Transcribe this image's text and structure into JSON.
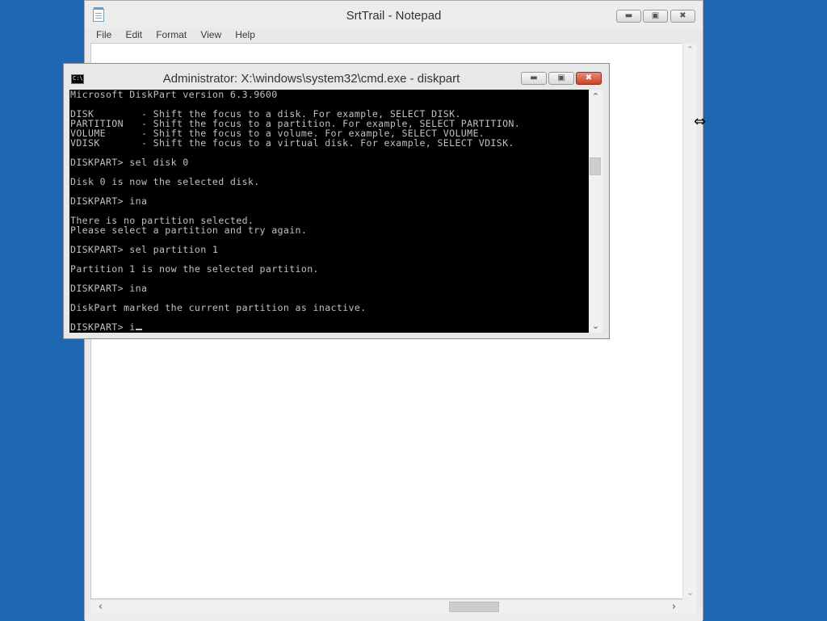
{
  "notepad": {
    "title": "SrtTrail - Notepad",
    "menu": [
      "File",
      "Edit",
      "Format",
      "View",
      "Help"
    ],
    "icons": {
      "app": "notepad-icon",
      "minimize": "minimize-icon",
      "maximize": "maximize-icon",
      "close": "close-icon"
    }
  },
  "cmd": {
    "title": "Administrator: X:\\windows\\system32\\cmd.exe - diskpart",
    "icons": {
      "app": "console-icon",
      "minimize": "minimize-icon",
      "maximize": "maximize-icon",
      "close": "close-icon"
    },
    "lines": [
      "Microsoft DiskPart version 6.3.9600",
      "",
      "DISK        - Shift the focus to a disk. For example, SELECT DISK.",
      "PARTITION   - Shift the focus to a partition. For example, SELECT PARTITION.",
      "VOLUME      - Shift the focus to a volume. For example, SELECT VOLUME.",
      "VDISK       - Shift the focus to a virtual disk. For example, SELECT VDISK.",
      "",
      "DISKPART> sel disk 0",
      "",
      "Disk 0 is now the selected disk.",
      "",
      "DISKPART> ina",
      "",
      "There is no partition selected.",
      "Please select a partition and try again.",
      "",
      "DISKPART> sel partition 1",
      "",
      "Partition 1 is now the selected partition.",
      "",
      "DISKPART> ina",
      "",
      "DiskPart marked the current partition as inactive.",
      "",
      "DISKPART> i"
    ]
  },
  "cursor": {
    "icon": "horizontal-resize-cursor-icon"
  }
}
